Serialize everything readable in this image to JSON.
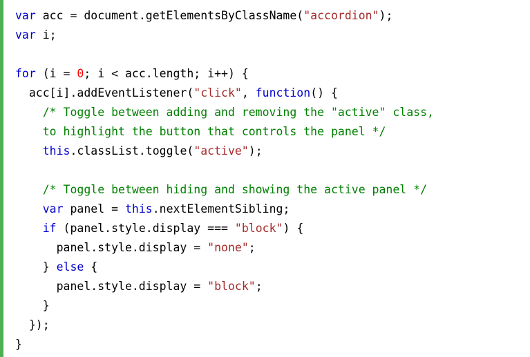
{
  "code_example": {
    "colors": {
      "accent_bar": "#4caf50",
      "keyword": "#0000cd",
      "string": "#a52a2a",
      "number": "#ff0000",
      "comment": "#008000",
      "plain": "#000000"
    },
    "lines": [
      [
        {
          "t": "kw",
          "v": "var"
        },
        {
          "t": "plain",
          "v": " acc = document.getElementsByClassName("
        },
        {
          "t": "str",
          "v": "\"accordion\""
        },
        {
          "t": "plain",
          "v": ");"
        }
      ],
      [
        {
          "t": "kw",
          "v": "var"
        },
        {
          "t": "plain",
          "v": " i;"
        }
      ],
      [],
      [
        {
          "t": "kw",
          "v": "for"
        },
        {
          "t": "plain",
          "v": " (i = "
        },
        {
          "t": "num",
          "v": "0"
        },
        {
          "t": "plain",
          "v": "; i < acc.length; i++) {"
        }
      ],
      [
        {
          "t": "plain",
          "v": "  acc[i].addEventListener("
        },
        {
          "t": "str",
          "v": "\"click\""
        },
        {
          "t": "plain",
          "v": ", "
        },
        {
          "t": "kw",
          "v": "function"
        },
        {
          "t": "plain",
          "v": "() {"
        }
      ],
      [
        {
          "t": "com",
          "v": "    /* Toggle between adding and removing the \"active\" class,"
        }
      ],
      [
        {
          "t": "com",
          "v": "    to highlight the button that controls the panel */"
        }
      ],
      [
        {
          "t": "plain",
          "v": "    "
        },
        {
          "t": "kw",
          "v": "this"
        },
        {
          "t": "plain",
          "v": ".classList.toggle("
        },
        {
          "t": "str",
          "v": "\"active\""
        },
        {
          "t": "plain",
          "v": ");"
        }
      ],
      [],
      [
        {
          "t": "com",
          "v": "    /* Toggle between hiding and showing the active panel */"
        }
      ],
      [
        {
          "t": "plain",
          "v": "    "
        },
        {
          "t": "kw",
          "v": "var"
        },
        {
          "t": "plain",
          "v": " panel = "
        },
        {
          "t": "kw",
          "v": "this"
        },
        {
          "t": "plain",
          "v": ".nextElementSibling;"
        }
      ],
      [
        {
          "t": "plain",
          "v": "    "
        },
        {
          "t": "kw",
          "v": "if"
        },
        {
          "t": "plain",
          "v": " (panel.style.display === "
        },
        {
          "t": "str",
          "v": "\"block\""
        },
        {
          "t": "plain",
          "v": ") {"
        }
      ],
      [
        {
          "t": "plain",
          "v": "      panel.style.display = "
        },
        {
          "t": "str",
          "v": "\"none\""
        },
        {
          "t": "plain",
          "v": ";"
        }
      ],
      [
        {
          "t": "plain",
          "v": "    } "
        },
        {
          "t": "kw",
          "v": "else"
        },
        {
          "t": "plain",
          "v": " {"
        }
      ],
      [
        {
          "t": "plain",
          "v": "      panel.style.display = "
        },
        {
          "t": "str",
          "v": "\"block\""
        },
        {
          "t": "plain",
          "v": ";"
        }
      ],
      [
        {
          "t": "plain",
          "v": "    }"
        }
      ],
      [
        {
          "t": "plain",
          "v": "  });"
        }
      ],
      [
        {
          "t": "plain",
          "v": "}"
        }
      ]
    ]
  }
}
